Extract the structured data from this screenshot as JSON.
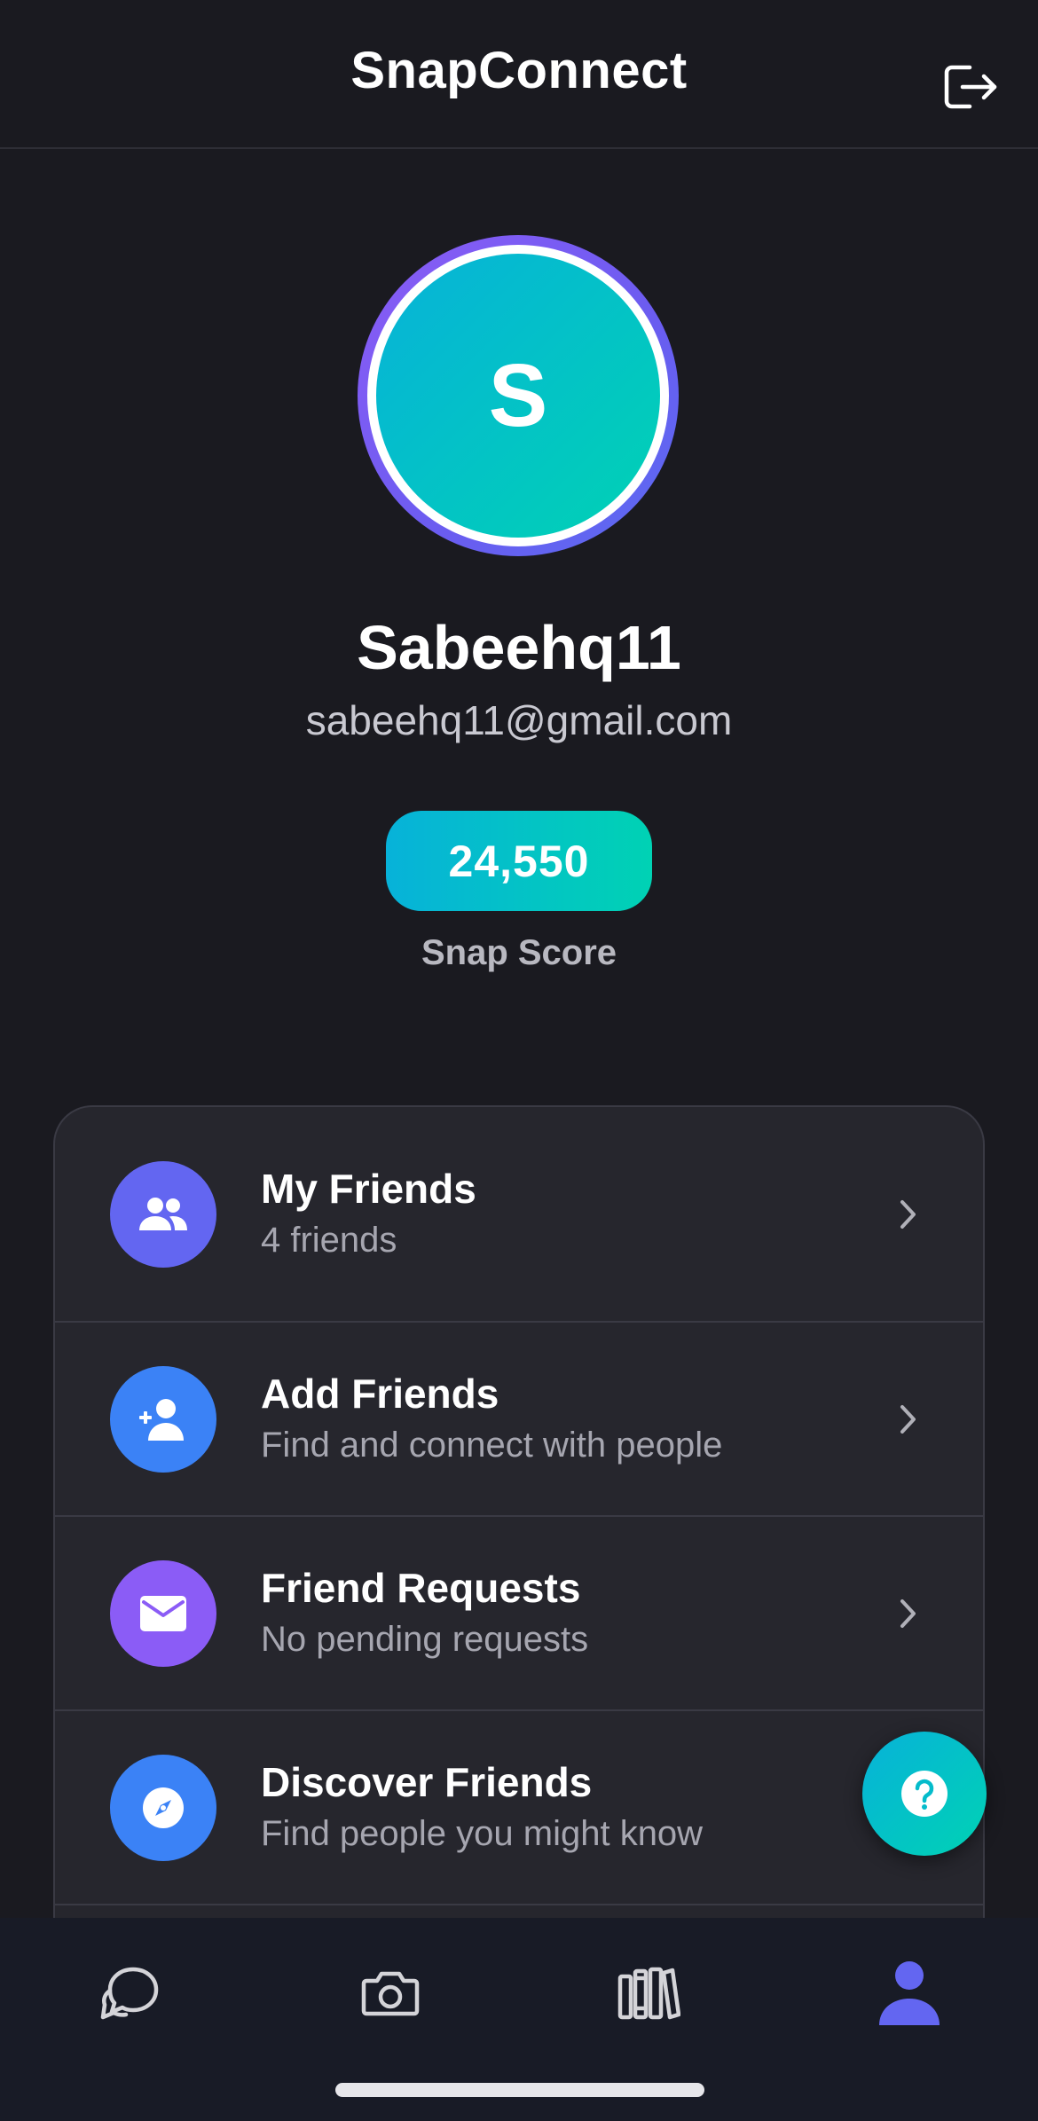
{
  "header": {
    "title": "SnapConnect",
    "logout_icon": "logout-icon"
  },
  "profile": {
    "avatar_initial": "S",
    "username": "Sabeehq11",
    "email": "sabeehq11@gmail.com",
    "snap_score": "24,550",
    "snap_score_label": "Snap Score"
  },
  "menu": {
    "items": [
      {
        "title": "My Friends",
        "subtitle": "4 friends",
        "icon": "friends-icon",
        "color": "#6366f1"
      },
      {
        "title": "Add Friends",
        "subtitle": "Find and connect with people",
        "icon": "add-user-icon",
        "color": "#3b82f6"
      },
      {
        "title": "Friend Requests",
        "subtitle": "No pending requests",
        "icon": "mail-icon",
        "color": "#8b5cf6"
      },
      {
        "title": "Discover Friends",
        "subtitle": "Find people you might know",
        "icon": "compass-icon",
        "color": "#3b82f6"
      }
    ]
  },
  "help_fab": {
    "icon": "help-icon"
  },
  "tabbar": {
    "tabs": [
      {
        "name": "chats",
        "icon": "chat-icon",
        "active": false
      },
      {
        "name": "camera",
        "icon": "camera-icon",
        "active": false
      },
      {
        "name": "stories",
        "icon": "library-icon",
        "active": false
      },
      {
        "name": "profile",
        "icon": "profile-icon",
        "active": true
      }
    ],
    "active_color": "#6366f1",
    "inactive_color": "#d4d4d8"
  },
  "colors": {
    "background": "#1a1a20",
    "accent_gradient_start": "#07b2d9",
    "accent_gradient_end": "#00d2b4",
    "ring": "#7c5cf4"
  }
}
